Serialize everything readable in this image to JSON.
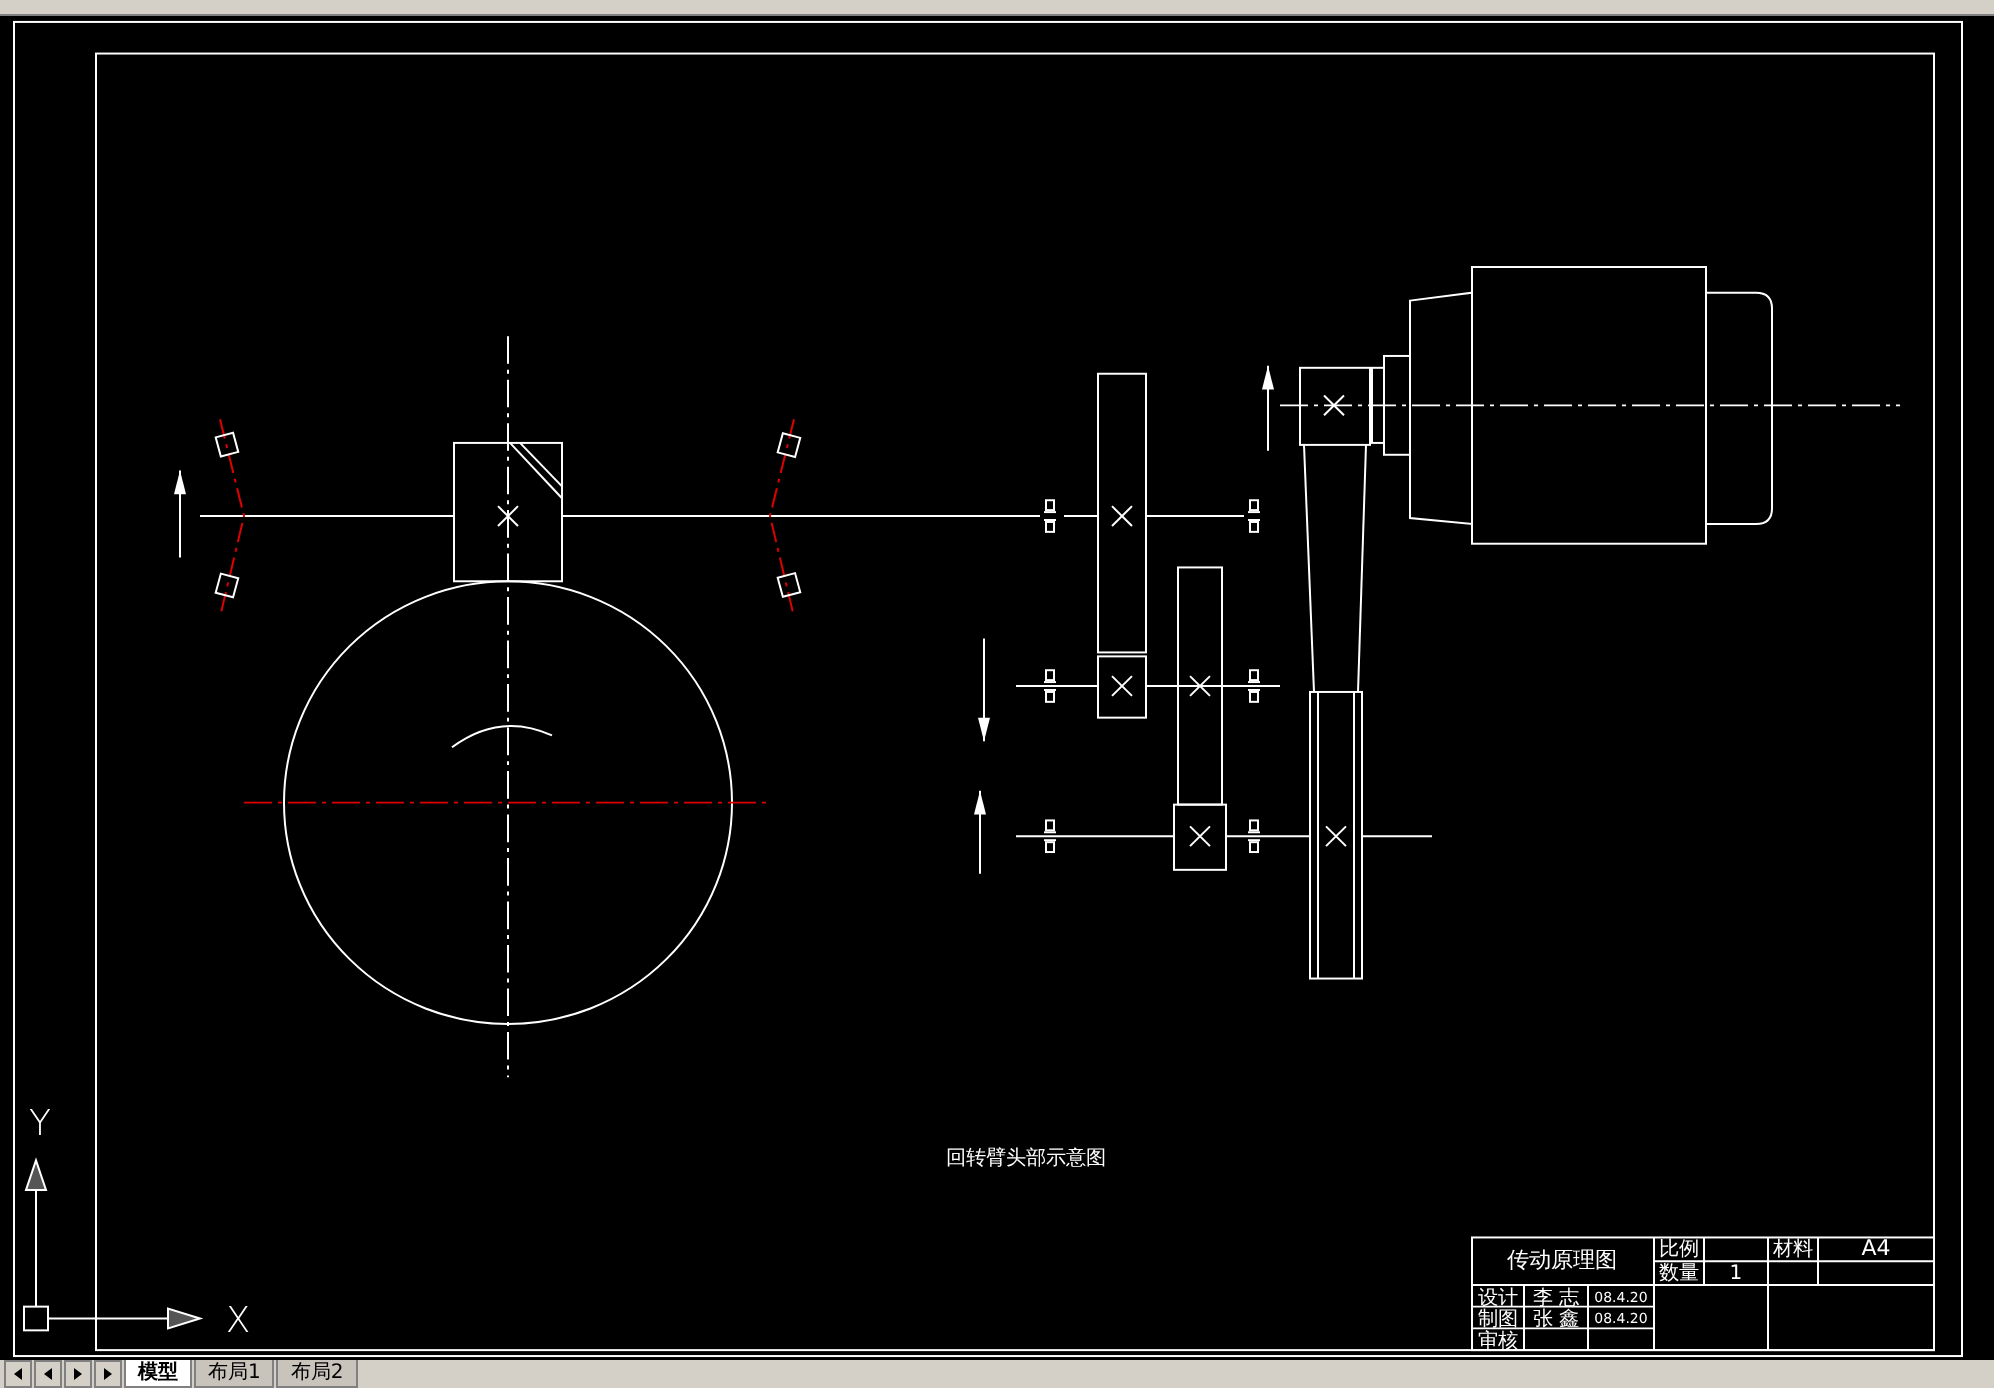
{
  "caption": "回转臂头部示意图",
  "title_block": {
    "title": "传动原理图",
    "header": [
      {
        "label": "比例"
      },
      {
        "label": "材料",
        "value": "A4"
      }
    ],
    "quantity": {
      "label": "数量",
      "value": "1"
    },
    "people": [
      {
        "role": "设计",
        "name": "李 志",
        "date": "08.4.20"
      },
      {
        "role": "制图",
        "name": "张 鑫",
        "date": "08.4.20"
      },
      {
        "role": "审核"
      }
    ]
  },
  "ucs": {
    "x_label": "X",
    "y_label": "Y"
  },
  "tabs": [
    {
      "label": "模型",
      "selected": true
    },
    {
      "label": "布局1",
      "selected": false
    },
    {
      "label": "布局2",
      "selected": false
    }
  ]
}
